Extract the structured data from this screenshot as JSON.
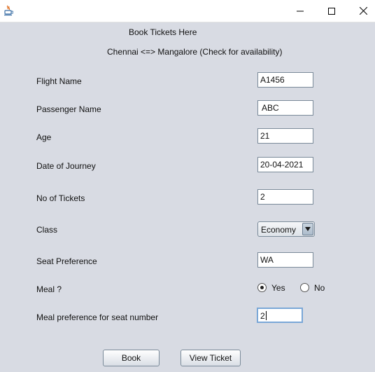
{
  "window": {
    "icon": "java-icon",
    "controls": {
      "minimize": "minimize-icon",
      "maximize": "maximize-icon",
      "close": "close-icon"
    }
  },
  "header": {
    "title": "Book Tickets Here",
    "route": "Chennai <=> Mangalore (Check for availability)"
  },
  "form": {
    "flight_name": {
      "label": "Flight Name",
      "value": "A1456"
    },
    "passenger_name": {
      "label": "Passenger Name",
      "value": "ABC"
    },
    "age": {
      "label": "Age",
      "value": "21"
    },
    "date_of_journey": {
      "label": "Date of Journey",
      "value": "20-04-2021"
    },
    "no_of_tickets": {
      "label": "No of Tickets",
      "value": "2"
    },
    "class": {
      "label": "Class",
      "value": "Economy"
    },
    "seat_preference": {
      "label": "Seat Preference",
      "value": "WA"
    },
    "meal": {
      "label": "Meal ?",
      "yes": "Yes",
      "no": "No",
      "selected": "Yes"
    },
    "meal_seat": {
      "label": "Meal preference for seat number",
      "value": "2"
    }
  },
  "buttons": {
    "book": "Book",
    "view_ticket": "View Ticket"
  }
}
